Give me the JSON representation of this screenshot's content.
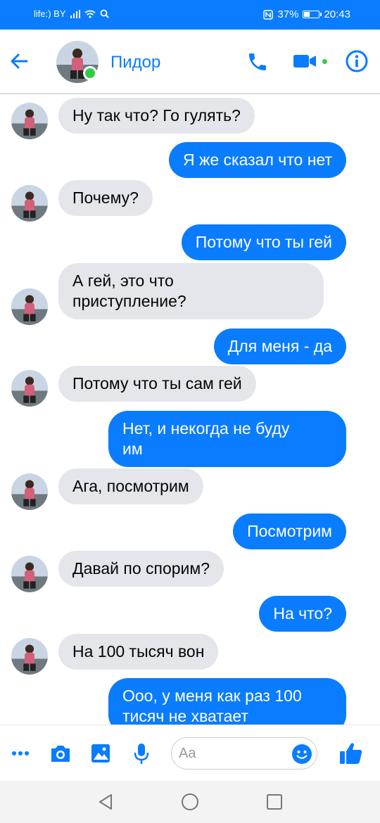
{
  "status_bar": {
    "carrier": "life:) BY",
    "battery": "37%",
    "time": "20:43"
  },
  "header": {
    "contact_name": "Пидор"
  },
  "messages": [
    {
      "direction": "in",
      "lines": [
        "Ну так что? Го гулять?"
      ]
    },
    {
      "direction": "out",
      "lines": [
        "Я же сказал что нет"
      ]
    },
    {
      "direction": "in",
      "lines": [
        "Почему?"
      ]
    },
    {
      "direction": "out",
      "lines": [
        "Потому что ты гей"
      ]
    },
    {
      "direction": "in",
      "lines": [
        "А гей, это что",
        "приступление?"
      ]
    },
    {
      "direction": "out",
      "lines": [
        "Для меня - да"
      ]
    },
    {
      "direction": "in",
      "lines": [
        "Потому что ты сам гей"
      ]
    },
    {
      "direction": "out",
      "lines": [
        "Нет, и некогда не буду",
        "им"
      ]
    },
    {
      "direction": "in",
      "lines": [
        "Ага, посмотрим"
      ]
    },
    {
      "direction": "out",
      "lines": [
        "Посмотрим"
      ]
    },
    {
      "direction": "in",
      "lines": [
        "Давай по спорим?"
      ]
    },
    {
      "direction": "out",
      "lines": [
        "На что?"
      ]
    },
    {
      "direction": "in",
      "lines": [
        "На 100 тысяч вон"
      ]
    },
    {
      "direction": "out",
      "lines": [
        "Ооо, у меня как раз 100",
        "тисяч не хватает"
      ]
    }
  ],
  "composer": {
    "placeholder": "Aa"
  },
  "colors": {
    "accent": "#0a7cff",
    "incoming_bubble": "#e4e6eb",
    "online": "#31cc46"
  },
  "icons": {
    "header": [
      "back-arrow-icon",
      "phone-icon",
      "video-camera-icon",
      "info-icon"
    ],
    "composer": [
      "more-icon",
      "camera-icon",
      "gallery-icon",
      "microphone-icon",
      "emoji-icon",
      "thumbs-up-icon"
    ],
    "navbar": [
      "back-triangle-icon",
      "home-circle-icon",
      "recents-square-icon"
    ]
  }
}
